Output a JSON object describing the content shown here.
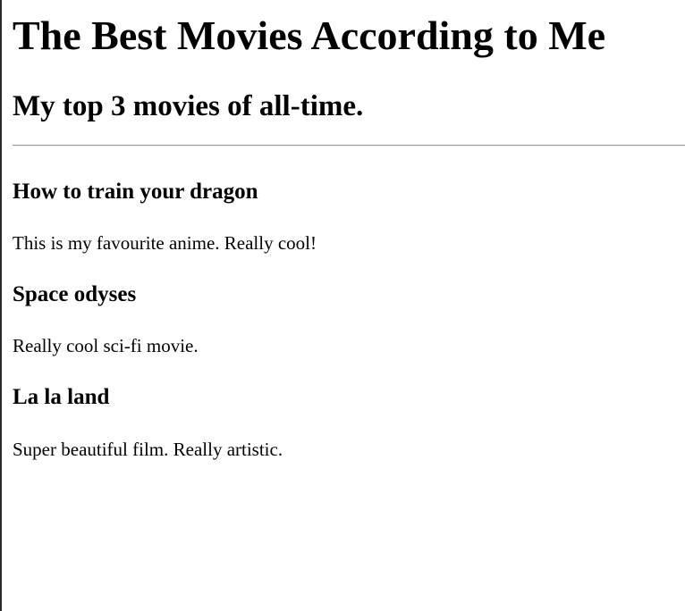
{
  "page": {
    "title": "The Best Movies According to Me",
    "subtitle": "My top 3 movies of all-time."
  },
  "movies": [
    {
      "title": "How to train your dragon",
      "description": "This is my favourite anime. Really cool!"
    },
    {
      "title": "Space odyses",
      "description": "Really cool sci-fi movie."
    },
    {
      "title": "La la land",
      "description": "Super beautiful film. Really artistic."
    }
  ]
}
